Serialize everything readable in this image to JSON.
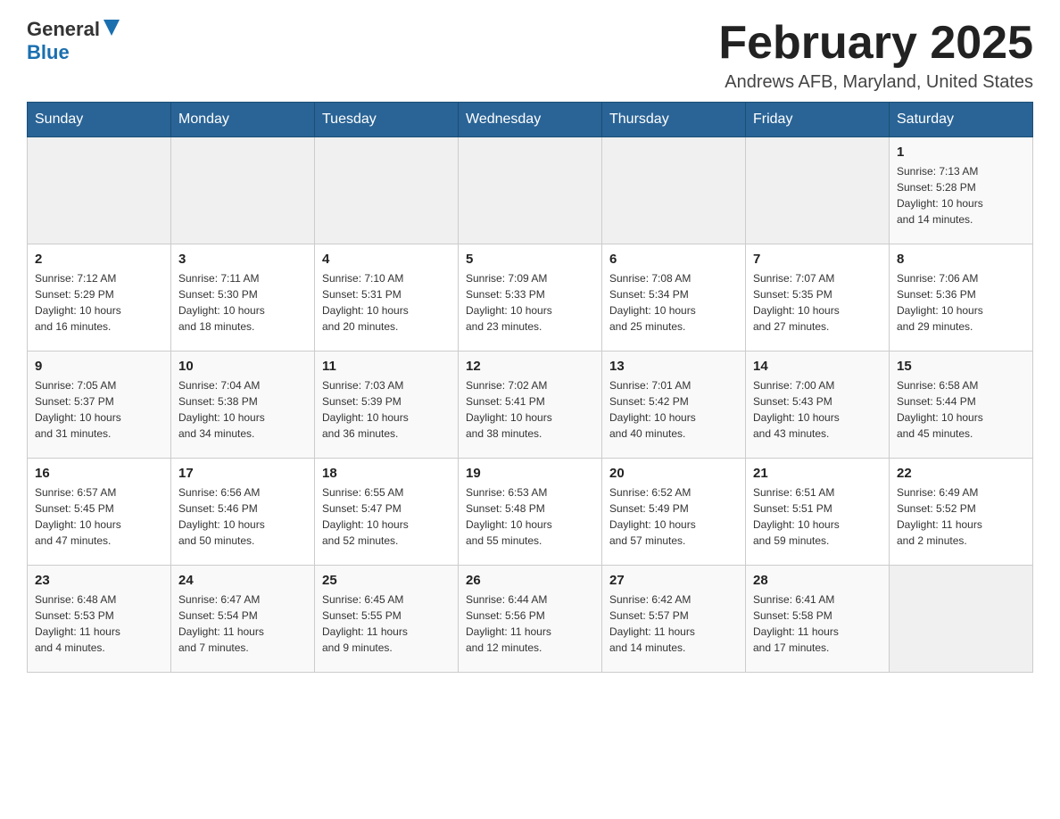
{
  "header": {
    "logo_general": "General",
    "logo_blue": "Blue",
    "title": "February 2025",
    "location": "Andrews AFB, Maryland, United States"
  },
  "days_of_week": [
    "Sunday",
    "Monday",
    "Tuesday",
    "Wednesday",
    "Thursday",
    "Friday",
    "Saturday"
  ],
  "weeks": [
    {
      "cells": [
        {
          "day": "",
          "info": ""
        },
        {
          "day": "",
          "info": ""
        },
        {
          "day": "",
          "info": ""
        },
        {
          "day": "",
          "info": ""
        },
        {
          "day": "",
          "info": ""
        },
        {
          "day": "",
          "info": ""
        },
        {
          "day": "1",
          "info": "Sunrise: 7:13 AM\nSunset: 5:28 PM\nDaylight: 10 hours\nand 14 minutes."
        }
      ]
    },
    {
      "cells": [
        {
          "day": "2",
          "info": "Sunrise: 7:12 AM\nSunset: 5:29 PM\nDaylight: 10 hours\nand 16 minutes."
        },
        {
          "day": "3",
          "info": "Sunrise: 7:11 AM\nSunset: 5:30 PM\nDaylight: 10 hours\nand 18 minutes."
        },
        {
          "day": "4",
          "info": "Sunrise: 7:10 AM\nSunset: 5:31 PM\nDaylight: 10 hours\nand 20 minutes."
        },
        {
          "day": "5",
          "info": "Sunrise: 7:09 AM\nSunset: 5:33 PM\nDaylight: 10 hours\nand 23 minutes."
        },
        {
          "day": "6",
          "info": "Sunrise: 7:08 AM\nSunset: 5:34 PM\nDaylight: 10 hours\nand 25 minutes."
        },
        {
          "day": "7",
          "info": "Sunrise: 7:07 AM\nSunset: 5:35 PM\nDaylight: 10 hours\nand 27 minutes."
        },
        {
          "day": "8",
          "info": "Sunrise: 7:06 AM\nSunset: 5:36 PM\nDaylight: 10 hours\nand 29 minutes."
        }
      ]
    },
    {
      "cells": [
        {
          "day": "9",
          "info": "Sunrise: 7:05 AM\nSunset: 5:37 PM\nDaylight: 10 hours\nand 31 minutes."
        },
        {
          "day": "10",
          "info": "Sunrise: 7:04 AM\nSunset: 5:38 PM\nDaylight: 10 hours\nand 34 minutes."
        },
        {
          "day": "11",
          "info": "Sunrise: 7:03 AM\nSunset: 5:39 PM\nDaylight: 10 hours\nand 36 minutes."
        },
        {
          "day": "12",
          "info": "Sunrise: 7:02 AM\nSunset: 5:41 PM\nDaylight: 10 hours\nand 38 minutes."
        },
        {
          "day": "13",
          "info": "Sunrise: 7:01 AM\nSunset: 5:42 PM\nDaylight: 10 hours\nand 40 minutes."
        },
        {
          "day": "14",
          "info": "Sunrise: 7:00 AM\nSunset: 5:43 PM\nDaylight: 10 hours\nand 43 minutes."
        },
        {
          "day": "15",
          "info": "Sunrise: 6:58 AM\nSunset: 5:44 PM\nDaylight: 10 hours\nand 45 minutes."
        }
      ]
    },
    {
      "cells": [
        {
          "day": "16",
          "info": "Sunrise: 6:57 AM\nSunset: 5:45 PM\nDaylight: 10 hours\nand 47 minutes."
        },
        {
          "day": "17",
          "info": "Sunrise: 6:56 AM\nSunset: 5:46 PM\nDaylight: 10 hours\nand 50 minutes."
        },
        {
          "day": "18",
          "info": "Sunrise: 6:55 AM\nSunset: 5:47 PM\nDaylight: 10 hours\nand 52 minutes."
        },
        {
          "day": "19",
          "info": "Sunrise: 6:53 AM\nSunset: 5:48 PM\nDaylight: 10 hours\nand 55 minutes."
        },
        {
          "day": "20",
          "info": "Sunrise: 6:52 AM\nSunset: 5:49 PM\nDaylight: 10 hours\nand 57 minutes."
        },
        {
          "day": "21",
          "info": "Sunrise: 6:51 AM\nSunset: 5:51 PM\nDaylight: 10 hours\nand 59 minutes."
        },
        {
          "day": "22",
          "info": "Sunrise: 6:49 AM\nSunset: 5:52 PM\nDaylight: 11 hours\nand 2 minutes."
        }
      ]
    },
    {
      "cells": [
        {
          "day": "23",
          "info": "Sunrise: 6:48 AM\nSunset: 5:53 PM\nDaylight: 11 hours\nand 4 minutes."
        },
        {
          "day": "24",
          "info": "Sunrise: 6:47 AM\nSunset: 5:54 PM\nDaylight: 11 hours\nand 7 minutes."
        },
        {
          "day": "25",
          "info": "Sunrise: 6:45 AM\nSunset: 5:55 PM\nDaylight: 11 hours\nand 9 minutes."
        },
        {
          "day": "26",
          "info": "Sunrise: 6:44 AM\nSunset: 5:56 PM\nDaylight: 11 hours\nand 12 minutes."
        },
        {
          "day": "27",
          "info": "Sunrise: 6:42 AM\nSunset: 5:57 PM\nDaylight: 11 hours\nand 14 minutes."
        },
        {
          "day": "28",
          "info": "Sunrise: 6:41 AM\nSunset: 5:58 PM\nDaylight: 11 hours\nand 17 minutes."
        },
        {
          "day": "",
          "info": ""
        }
      ]
    }
  ]
}
